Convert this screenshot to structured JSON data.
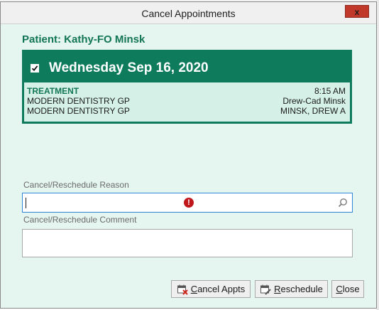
{
  "window": {
    "title": "Cancel Appointments",
    "close_glyph": "x"
  },
  "patient": {
    "label": "Patient: Kathy-FO Minsk"
  },
  "appointment": {
    "checked": true,
    "date": "Wednesday Sep 16, 2020",
    "type": "TREATMENT",
    "time": "8:15 AM",
    "location_1": "MODERN DENTISTRY GP",
    "provider_1": "Drew-Cad Minsk",
    "location_2": "MODERN DENTISTRY GP",
    "provider_2": "MINSK, DREW A"
  },
  "form": {
    "reason_label": "Cancel/Reschedule Reason",
    "reason_value": "",
    "reason_error_glyph": "!",
    "comment_label": "Cancel/Reschedule Comment",
    "comment_value": ""
  },
  "buttons": {
    "cancel_appts": {
      "underline": "C",
      "rest": "ancel Appts"
    },
    "reschedule": {
      "underline": "R",
      "rest": "eschedule"
    },
    "close": {
      "underline": "C",
      "rest": "lose"
    }
  },
  "icons": {
    "cancel_appts": "calendar-x-icon",
    "reschedule": "calendar-edit-icon",
    "search": "search-icon",
    "error": "error-icon",
    "checkbox": "checkbox-checked-icon"
  },
  "colors": {
    "accent_green": "#0e7b5c",
    "light_green_bg": "#e5f5ef",
    "error_red": "#c0171c",
    "focus_blue": "#2f86d6"
  }
}
